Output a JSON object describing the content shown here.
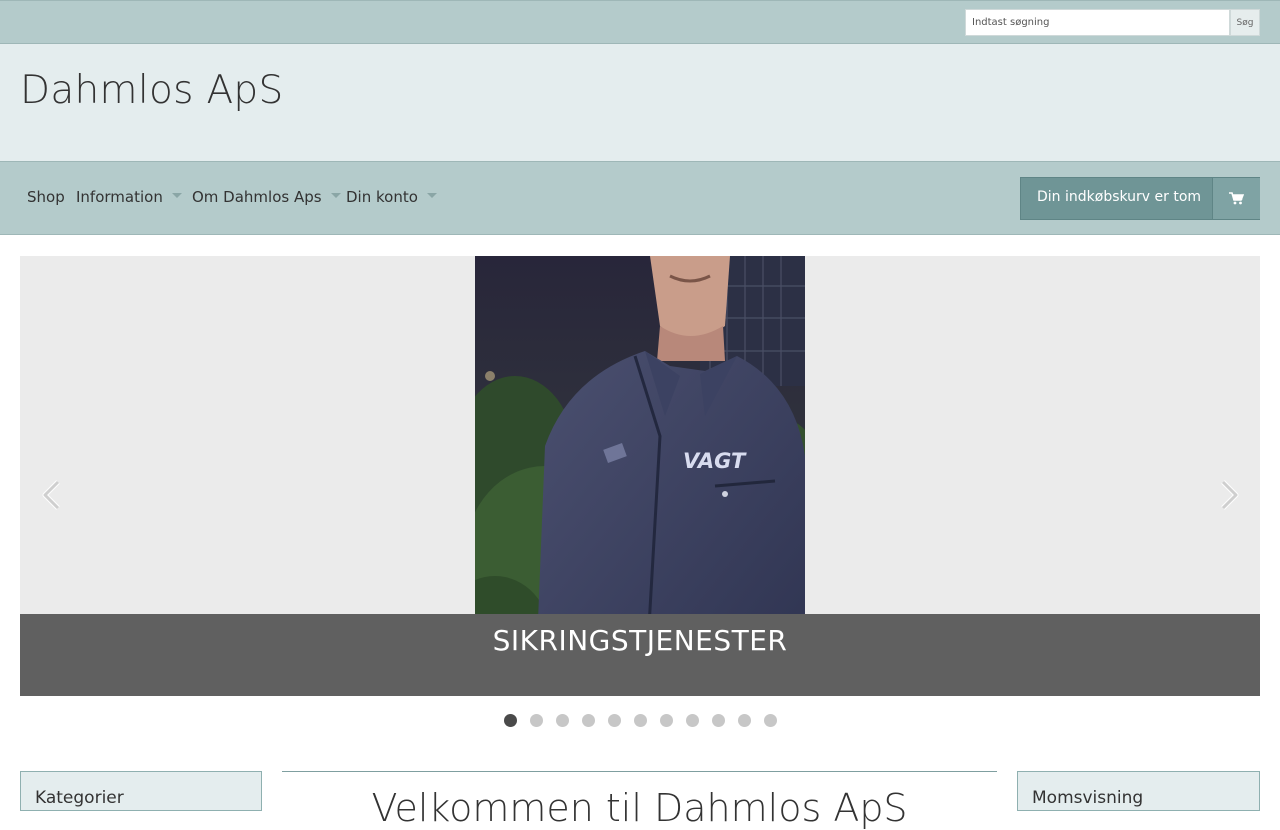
{
  "search": {
    "placeholder": "Indtast søgning",
    "button_label": "Søg"
  },
  "site": {
    "title": "Dahmlos ApS"
  },
  "nav": {
    "items": [
      {
        "label": "Shop",
        "has_dropdown": false
      },
      {
        "label": "Information",
        "has_dropdown": true
      },
      {
        "label": "Om Dahmlos Aps",
        "has_dropdown": true
      },
      {
        "label": "Din konto",
        "has_dropdown": true
      }
    ],
    "cart_label": "Din indkøbskurv er tom",
    "cart_icon": "shopping-cart-icon"
  },
  "carousel": {
    "caption": "SIKRINGSTJENESTER",
    "photo_jacket_text": "VAGT",
    "slide_count": 11,
    "active_index": 0,
    "prev_icon": "chevron-left-icon",
    "next_icon": "chevron-right-icon"
  },
  "sidebar_left": {
    "title": "Kategorier"
  },
  "main": {
    "heading": "Velkommen til Dahmlos ApS"
  },
  "sidebar_right": {
    "title": "Momsvisning"
  },
  "colors": {
    "bar": "#b4cbcb",
    "header_bg": "#e4edee",
    "cart_bg": "#6f9596",
    "caption_band": "#606060",
    "active_dot": "#4a4a4a"
  }
}
